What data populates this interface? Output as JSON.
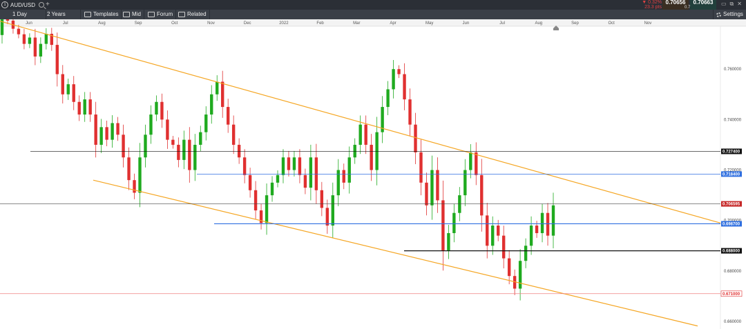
{
  "topbar": {
    "symbol": "AUD/USD",
    "change_pct": "▼ 0.32%",
    "change_pips": "23.3 pts",
    "bid": "0.70656",
    "ask": "0.70663",
    "spread": "0.7"
  },
  "toolbar": {
    "timeframe": "1 Day",
    "range": "2 Years",
    "templates": "Templates",
    "mid": "Mid",
    "forum": "Forum",
    "related": "Related",
    "settings": "Settings"
  },
  "colors": {
    "up": "#1faa1f",
    "down": "#e03030",
    "channel": "#f5a623",
    "blue": "#2f6fe0",
    "black": "#111111",
    "red": "#e03030"
  },
  "chart_data": {
    "type": "candlestick",
    "instrument": "AUD/USD",
    "x_months": [
      "Jun",
      "Jul",
      "Aug",
      "Sep",
      "Oct",
      "Nov",
      "Dec",
      "2022",
      "Feb",
      "Mar",
      "Apr",
      "May",
      "Jun",
      "Jul",
      "Aug",
      "Sep",
      "Oct",
      "Nov"
    ],
    "ylim": [
      0.657,
      0.777
    ],
    "y_ticks": [
      "0.760000",
      "0.740000",
      "0.720000",
      "0.700000",
      "0.680000",
      "0.660000"
    ],
    "candles": [
      [
        0.7735,
        0.7808
      ],
      [
        0.7808,
        0.7792
      ],
      [
        0.7792,
        0.776
      ],
      [
        0.776,
        0.7738
      ],
      [
        0.7738,
        0.77
      ],
      [
        0.77,
        0.7725
      ],
      [
        0.7725,
        0.765
      ],
      [
        0.765,
        0.77
      ],
      [
        0.77,
        0.774
      ],
      [
        0.774,
        0.7696
      ],
      [
        0.7696,
        0.758
      ],
      [
        0.758,
        0.75
      ],
      [
        0.75,
        0.754
      ],
      [
        0.754,
        0.747
      ],
      [
        0.747,
        0.742
      ],
      [
        0.742,
        0.748
      ],
      [
        0.748,
        0.742
      ],
      [
        0.742,
        0.73
      ],
      [
        0.73,
        0.737
      ],
      [
        0.737,
        0.732
      ],
      [
        0.732,
        0.7386
      ],
      [
        0.7386,
        0.734
      ],
      [
        0.734,
        0.725
      ],
      [
        0.725,
        0.716
      ],
      [
        0.716,
        0.711
      ],
      [
        0.711,
        0.725
      ],
      [
        0.725,
        0.734
      ],
      [
        0.734,
        0.742
      ],
      [
        0.742,
        0.747
      ],
      [
        0.747,
        0.74
      ],
      [
        0.74,
        0.732
      ],
      [
        0.732,
        0.73
      ],
      [
        0.73,
        0.724
      ],
      [
        0.724,
        0.732
      ],
      [
        0.732,
        0.72
      ],
      [
        0.72,
        0.73
      ],
      [
        0.73,
        0.735
      ],
      [
        0.735,
        0.742
      ],
      [
        0.742,
        0.75
      ],
      [
        0.75,
        0.755
      ],
      [
        0.755,
        0.745
      ],
      [
        0.745,
        0.738
      ],
      [
        0.738,
        0.73
      ],
      [
        0.73,
        0.725
      ],
      [
        0.725,
        0.718
      ],
      [
        0.718,
        0.712
      ],
      [
        0.712,
        0.704
      ],
      [
        0.704,
        0.699
      ],
      [
        0.699,
        0.71
      ],
      [
        0.71,
        0.715
      ],
      [
        0.715,
        0.718
      ],
      [
        0.718,
        0.725
      ],
      [
        0.725,
        0.72
      ],
      [
        0.72,
        0.725
      ],
      [
        0.725,
        0.718
      ],
      [
        0.718,
        0.713
      ],
      [
        0.713,
        0.725
      ],
      [
        0.725,
        0.712
      ],
      [
        0.712,
        0.705
      ],
      [
        0.705,
        0.698
      ],
      [
        0.698,
        0.71
      ],
      [
        0.71,
        0.72
      ],
      [
        0.72,
        0.715
      ],
      [
        0.715,
        0.725
      ],
      [
        0.725,
        0.73
      ],
      [
        0.73,
        0.738
      ],
      [
        0.738,
        0.73
      ],
      [
        0.73,
        0.72
      ],
      [
        0.72,
        0.735
      ],
      [
        0.735,
        0.745
      ],
      [
        0.745,
        0.752
      ],
      [
        0.752,
        0.76
      ],
      [
        0.76,
        0.758
      ],
      [
        0.758,
        0.748
      ],
      [
        0.748,
        0.738
      ],
      [
        0.738,
        0.727
      ],
      [
        0.727,
        0.715
      ],
      [
        0.715,
        0.706
      ],
      [
        0.706,
        0.72
      ],
      [
        0.72,
        0.708
      ],
      [
        0.708,
        0.688
      ],
      [
        0.688,
        0.695
      ],
      [
        0.695,
        0.703
      ],
      [
        0.703,
        0.71
      ],
      [
        0.71,
        0.72
      ],
      [
        0.72,
        0.727
      ],
      [
        0.727,
        0.718
      ],
      [
        0.718,
        0.702
      ],
      [
        0.702,
        0.69
      ],
      [
        0.69,
        0.698
      ],
      [
        0.698,
        0.694
      ],
      [
        0.694,
        0.685
      ],
      [
        0.685,
        0.678
      ],
      [
        0.678,
        0.673
      ],
      [
        0.673,
        0.684
      ],
      [
        0.684,
        0.69
      ],
      [
        0.69,
        0.698
      ],
      [
        0.698,
        0.695
      ],
      [
        0.695,
        0.703
      ],
      [
        0.703,
        0.694
      ],
      [
        0.694,
        0.706
      ]
    ],
    "horizontal_levels": [
      {
        "value": 0.7274,
        "label": "0.727400",
        "style": "black-thin"
      },
      {
        "value": 0.7184,
        "label": "0.718400",
        "style": "blue-thin"
      },
      {
        "value": 0.706595,
        "label": "0.706595",
        "style": "current"
      },
      {
        "value": 0.6987,
        "label": "0.698700",
        "style": "blue"
      },
      {
        "value": 0.688,
        "label": "0.688000",
        "style": "black"
      },
      {
        "value": 0.671,
        "label": "0.671000",
        "style": "red"
      }
    ],
    "channel_lines": [
      {
        "from_value": 0.779,
        "to_value": 0.699,
        "style": "upper"
      },
      {
        "from_value": 0.716,
        "to_value": 0.6582,
        "style": "lower"
      }
    ]
  }
}
